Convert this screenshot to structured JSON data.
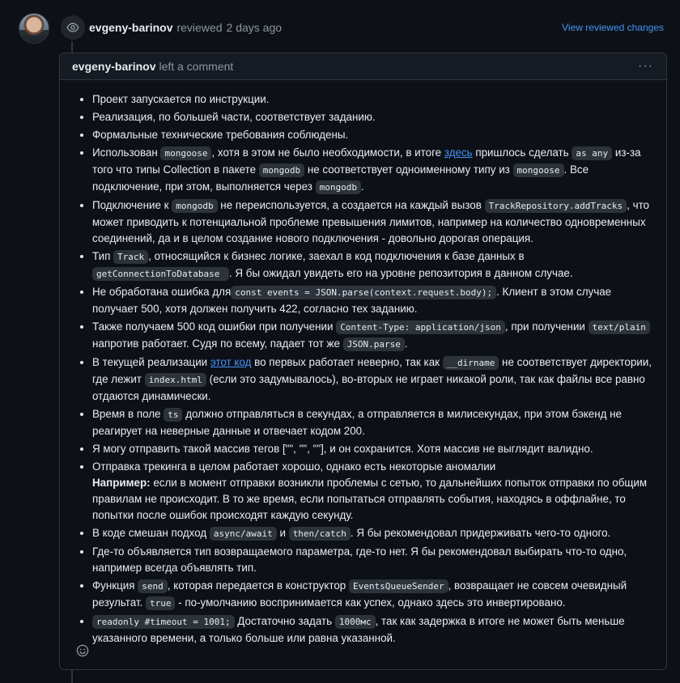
{
  "review": {
    "author": "evgeny-barinov",
    "action": "reviewed",
    "time": "2 days ago",
    "view_changes_label": "View reviewed changes"
  },
  "comment": {
    "author": "evgeny-barinov",
    "action": "left a comment",
    "menu_label": "···"
  },
  "items": {
    "i1": "Проект запускается по инструкции.",
    "i2": "Реализация, по большей части, соответствует заданию.",
    "i3": "Формальные технические требования соблюдены.",
    "i4": {
      "t1": "Использован ",
      "c1": "mongoose",
      "t2": ", хотя в этом не было необходимости, в итоге ",
      "link": "здесь",
      "t3": " пришлось сделать ",
      "c2": "as any",
      "t4": " из-за того что типы Collection в пакете ",
      "c3": "mongodb",
      "t5": " не соответствует одноименному типу из ",
      "c4": "mongoose",
      "t6": ". Все подключение, при этом, выполняется через ",
      "c5": "mongodb",
      "t7": "."
    },
    "i5": {
      "t1": "Подключение к ",
      "c1": "mongodb",
      "t2": " не переиспользуется, а создается на каждый вызов ",
      "c2": "TrackRepository.addTracks",
      "t3": ", что может приводить к потенциальной проблеме превышения лимитов, например на количество одновременных соединений, да и в целом создание нового подключения - довольно дорогая операция."
    },
    "i6": {
      "t1": "Тип ",
      "c1": "Track",
      "t2": ", относящийся к бизнес логике, заехал в код подключения к базе данных в ",
      "c2": "getConnectionToDatabase ",
      "t3": ". Я бы ожидал увидеть его на уровне репозитория в данном случае."
    },
    "i7": {
      "t1": "Не обработана ошибка для",
      "c1": "const events = JSON.parse(context.request.body);",
      "t2": ". Клиент в этом случае получает 500, хотя должен получить 422, согласно тех заданию."
    },
    "i8": {
      "t1": "Также получаем 500 код ошибки при получении ",
      "c1": "Content-Type: application/json",
      "t2": ", при получении ",
      "c2": "text/plain",
      "t3": " напротив работает. Судя по всему, падает тот же ",
      "c3": "JSON.parse",
      "t4": "."
    },
    "i9": {
      "t1": "В текущей реализации ",
      "link": "этот код",
      "t2": " во первых работает неверно, так как ",
      "c1": "__dirname",
      "t3": " не соответствует директории, где лежит ",
      "c2": "index.html",
      "t4": " (если это задумывалось), во-вторых не играет никакой роли, так как файлы все равно отдаются динамически."
    },
    "i10": {
      "t1": "Время в поле ",
      "c1": "ts",
      "t2": " должно отправляться в секундах, а отправляется в милисекундах, при этом бэкенд не реагирует на неверные данные и отвечает кодом 200."
    },
    "i11": "Я могу отправить такой массив тегов [\"\", \"\", \"\"], и он сохранится. Хотя массив не выглядит валидно.",
    "i12": {
      "t1": "Отправка трекинга в целом работает хорошо, однако есть некоторые аномалии",
      "bold": "Например:",
      "t2": " если в момент отправки возникли проблемы с сетью, то дальнейших попыток отправки по общим правилам не происходит. В то же время, если попытаться отправлять события, находясь в оффлайне, то попытки после ошибок происходят каждую секунду."
    },
    "i13": {
      "t1": "В коде смешан подход ",
      "c1": "async/await",
      "t2": " и ",
      "c2": "then/catch",
      "t3": ". Я бы рекомендовал придерживать чего-то одного."
    },
    "i14": "Где-то объявляется тип возвращаемого параметра, где-то нет. Я бы рекомендовал выбирать что-то одно, например всегда объявлять тип.",
    "i15": {
      "t1": "Функция ",
      "c1": "send",
      "t2": ", которая передается в конструктор ",
      "c2": "EventsQueueSender",
      "t3": ", возвращает не совсем очевидный результат. ",
      "c3": "true",
      "t4": " - по-умолчанию воспринимается как успех, однако здесь это инвертировано."
    },
    "i16": {
      "c1": "readonly #timeout = 1001;",
      "t1": " Достаточно задать ",
      "c2": "1000мс",
      "t2": ", так как задержка в итоге не может быть меньше указанного времени, а только больше или равна указанной."
    }
  },
  "icons": {
    "review": "eye-icon",
    "reaction": "smiley-icon",
    "menu": "kebab-horizontal-icon"
  },
  "colors": {
    "background": "#0d1117",
    "border": "#30363d",
    "link": "#4493f8",
    "muted": "#8d96a0",
    "code_bg": "#2d333b"
  }
}
